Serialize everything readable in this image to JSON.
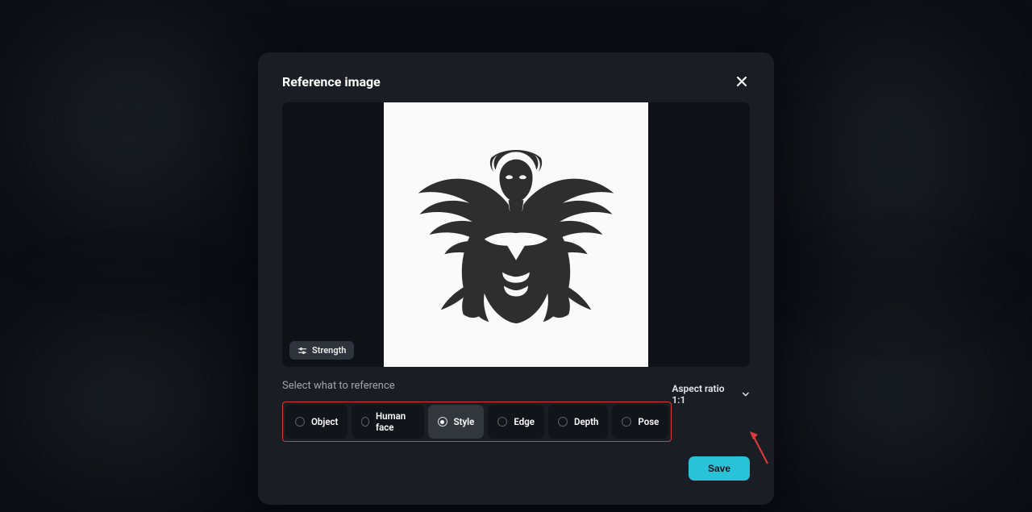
{
  "modal": {
    "title": "Reference image",
    "close_aria": "Close"
  },
  "strength": {
    "label": "Strength"
  },
  "reference_select": {
    "label": "Select what to reference",
    "options": [
      {
        "label": "Object",
        "selected": false
      },
      {
        "label": "Human face",
        "selected": false
      },
      {
        "label": "Style",
        "selected": true
      },
      {
        "label": "Edge",
        "selected": false
      },
      {
        "label": "Depth",
        "selected": false
      },
      {
        "label": "Pose",
        "selected": false
      }
    ]
  },
  "aspect_ratio": {
    "label": "Aspect ratio 1:1"
  },
  "actions": {
    "save": "Save"
  }
}
